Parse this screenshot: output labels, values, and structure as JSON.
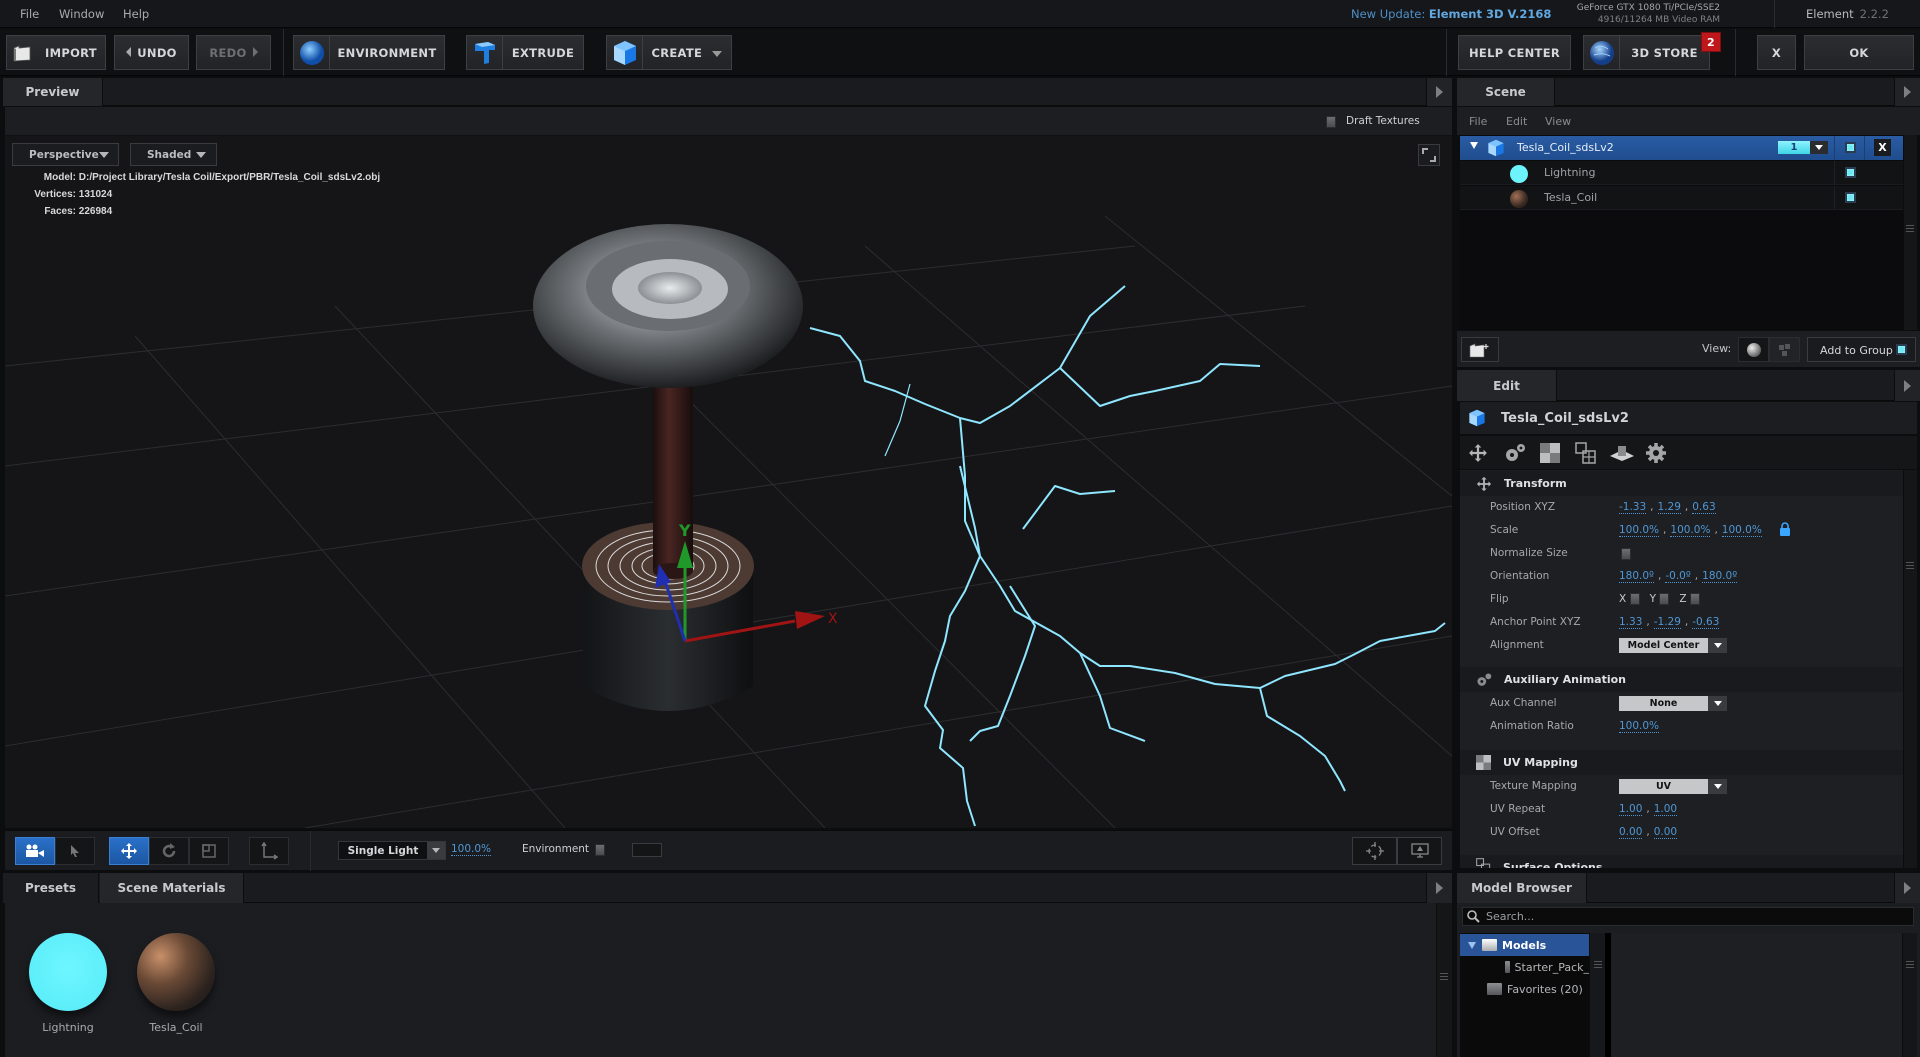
{
  "menu": {
    "items": [
      "File",
      "Window",
      "Help"
    ]
  },
  "update_notice": {
    "prefix": "New Update: ",
    "version": "Element 3D V.2168"
  },
  "gpu": {
    "name": "GeForce GTX 1080 Ti/PCIe/SSE2",
    "vram": "4916/11264 MB Video RAM"
  },
  "app": {
    "name": "Element",
    "version": "2.2.2"
  },
  "toolbar": {
    "import": "IMPORT",
    "undo": "UNDO",
    "redo": "REDO",
    "environment": "ENVIRONMENT",
    "extrude": "EXTRUDE",
    "create": "CREATE",
    "help_center": "HELP CENTER",
    "store": "3D STORE",
    "store_badge": "2",
    "cancel": "X",
    "ok": "OK"
  },
  "preview": {
    "tab": "Preview",
    "draft_textures_label": "Draft Textures",
    "draft_textures_checked": false,
    "camera_mode": "Perspective",
    "shading_mode": "Shaded",
    "info": {
      "model_label": "Model:",
      "model_path": "D:/Project Library/Tesla Coil/Export/PBR/Tesla_Coil_sdsLv2.obj",
      "vertices_label": "Vertices:",
      "vertices": "131024",
      "faces_label": "Faces:",
      "faces": "226984"
    },
    "gizmo": {
      "x": "X",
      "y": "Y"
    },
    "toolbar": {
      "lighting_mode": "Single Light",
      "lighting_value": "100.0%",
      "environment_label": "Environment",
      "environment_checked": false
    }
  },
  "bottom_left": {
    "tabs": [
      "Presets",
      "Scene Materials"
    ],
    "active_tab": "Scene Materials",
    "materials": [
      {
        "name": "Lightning",
        "color": "#5cf0fb"
      },
      {
        "name": "Tesla_Coil",
        "color": "#6b4a36"
      }
    ]
  },
  "scene": {
    "tab": "Scene",
    "menu": [
      "File",
      "Edit",
      "View"
    ],
    "group": {
      "name": "Tesla_Coil_sdsLv2",
      "group_number": "1",
      "visible": true,
      "close": "X"
    },
    "children": [
      {
        "name": "Lightning",
        "visible": true
      },
      {
        "name": "Tesla_Coil",
        "visible": true
      }
    ],
    "footer": {
      "view_label": "View:",
      "add_to_group": "Add to Group"
    }
  },
  "edit": {
    "tab": "Edit",
    "object_name": "Tesla_Coil_sdsLv2",
    "sections": {
      "transform": {
        "title": "Transform",
        "position_label": "Position XYZ",
        "position": [
          "-1.33",
          "1.29",
          "0.63"
        ],
        "scale_label": "Scale",
        "scale": [
          "100.0%",
          "100.0%",
          "100.0%"
        ],
        "normalize_label": "Normalize Size",
        "normalize_checked": false,
        "orientation_label": "Orientation",
        "orientation": [
          "180.0º",
          "-0.0º",
          "180.0º"
        ],
        "flip_label": "Flip",
        "flip_axes": [
          "X",
          "Y",
          "Z"
        ],
        "anchor_label": "Anchor Point XYZ",
        "anchor": [
          "1.33",
          "-1.29",
          "-0.63"
        ],
        "alignment_label": "Alignment",
        "alignment": "Model Center"
      },
      "aux": {
        "title": "Auxiliary Animation",
        "channel_label": "Aux Channel",
        "channel": "None",
        "ratio_label": "Animation Ratio",
        "ratio": "100.0%"
      },
      "uv": {
        "title": "UV Mapping",
        "mapping_label": "Texture Mapping",
        "mapping": "UV",
        "repeat_label": "UV Repeat",
        "repeat": [
          "1.00",
          "1.00"
        ],
        "offset_label": "UV Offset",
        "offset": [
          "0.00",
          "0.00"
        ]
      },
      "next_partial": "Surface Options"
    }
  },
  "model_browser": {
    "tab": "Model Browser",
    "search_placeholder": "Search...",
    "tree": [
      {
        "name": "Models",
        "selected": true,
        "expanded": true
      },
      {
        "name": "Starter_Pack_",
        "indent": 1
      },
      {
        "name": "Favorites (20)"
      }
    ]
  },
  "colors": {
    "accent_blue": "#2a5ca4",
    "link_blue": "#4f97d4",
    "cyan": "#6fe7f2",
    "badge_red": "#c0171c"
  }
}
